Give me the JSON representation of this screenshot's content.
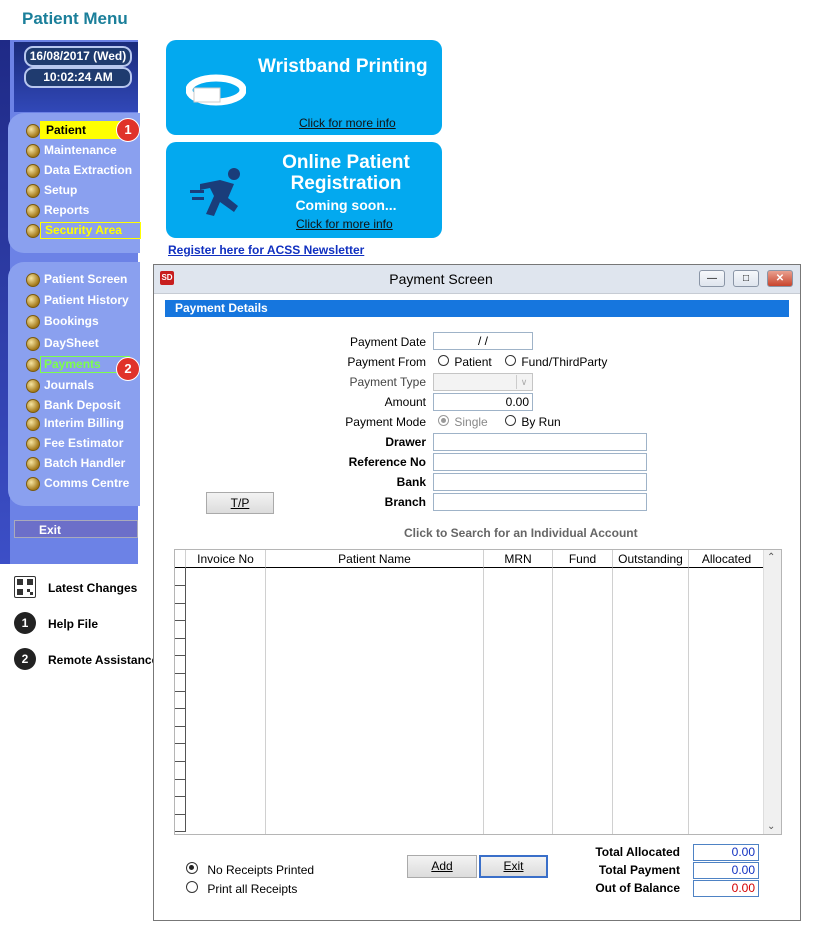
{
  "page": {
    "title": "Patient Menu"
  },
  "clock": {
    "date": "16/08/2017 (Wed)",
    "time": "10:02:24 AM"
  },
  "menu_top": [
    {
      "label": "Patient"
    },
    {
      "label": "Maintenance"
    },
    {
      "label": "Data Extraction"
    },
    {
      "label": "Setup"
    },
    {
      "label": "Reports"
    },
    {
      "label": "Security Area"
    }
  ],
  "menu_patient": [
    {
      "label": "Patient Screen"
    },
    {
      "label": "Patient History"
    },
    {
      "label": "Bookings"
    },
    {
      "label": "DaySheet"
    },
    {
      "label": "Payments"
    },
    {
      "label": "Journals"
    },
    {
      "label": "Bank Deposit"
    },
    {
      "label": "Interim Billing"
    },
    {
      "label": "Fee Estimator"
    },
    {
      "label": "Batch Handler"
    },
    {
      "label": "Comms Centre"
    }
  ],
  "badges": {
    "one": "1",
    "two": "2"
  },
  "exit_label": "Exit",
  "side_links": [
    {
      "icon": "",
      "label": "Latest Changes"
    },
    {
      "icon": "1",
      "label": "Help File"
    },
    {
      "icon": "2",
      "label": "Remote Assistance"
    }
  ],
  "banners": {
    "wristband": {
      "title": "Wristband Printing",
      "link": "Click for more info"
    },
    "online": {
      "title_line1": "Online Patient",
      "title_line2": "Registration",
      "subtitle": "Coming soon...",
      "link": "Click for more info"
    }
  },
  "newsletter_link": "Register here for ACSS Newsletter",
  "window": {
    "icon_text": "SD",
    "title": "Payment Screen",
    "section": "Payment Details",
    "fields": {
      "payment_date_label": "Payment Date",
      "payment_date_value": "/ /",
      "payment_from_label": "Payment From",
      "from_patient": "Patient",
      "from_fund": "Fund/ThirdParty",
      "payment_type_label": "Payment Type",
      "payment_type_value": "",
      "amount_label": "Amount",
      "amount_value": "0.00",
      "payment_mode_label": "Payment Mode",
      "mode_single": "Single",
      "mode_run": "By Run",
      "drawer_label": "Drawer",
      "drawer_value": "",
      "reference_label": "Reference No",
      "reference_value": "",
      "bank_label": "Bank",
      "bank_value": "",
      "branch_label": "Branch",
      "branch_value": ""
    },
    "tp_button": "T/P",
    "search_hint": "Click to Search for an Individual Account",
    "table": {
      "columns": [
        "Invoice No",
        "Patient Name",
        "MRN",
        "Fund",
        "Outstanding",
        "Allocated"
      ],
      "rows": []
    },
    "receipts": {
      "none": "No Receipts Printed",
      "all": "Print all Receipts"
    },
    "add_button": "Add",
    "exit_button": "Exit",
    "totals": {
      "allocated_label": "Total Allocated",
      "allocated_value": "0.00",
      "payment_label": "Total Payment",
      "payment_value": "0.00",
      "balance_label": "Out of Balance",
      "balance_value": "0.00"
    }
  },
  "colors": {
    "accent": "#1676de",
    "banner": "#03a9ef",
    "badge": "#e0322a",
    "balance": "#d40000"
  }
}
